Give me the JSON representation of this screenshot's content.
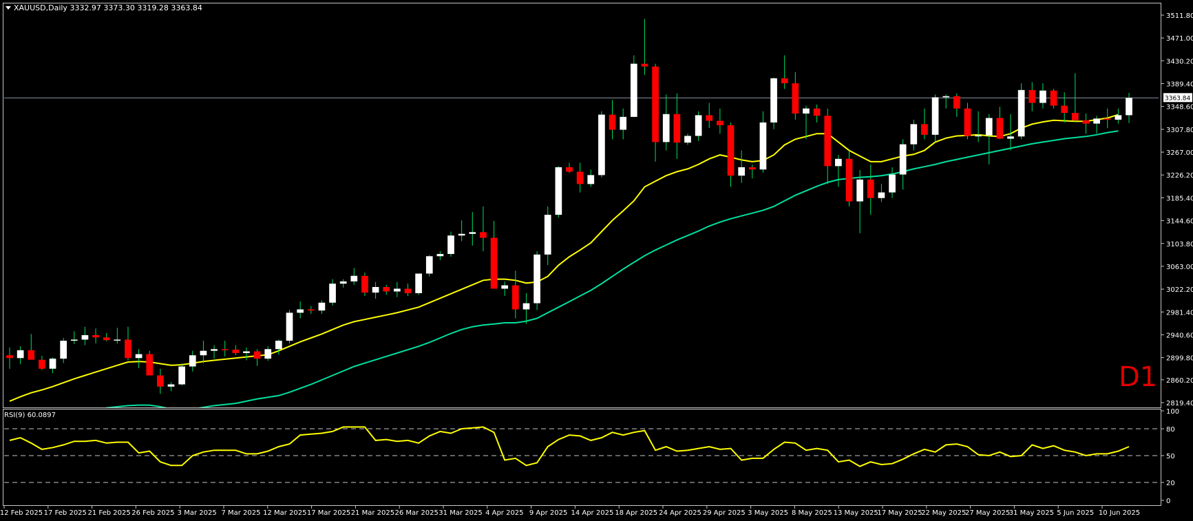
{
  "header": {
    "symbol_info": "XAUUSD,Daily  3332.97 3373.30 3319.28 3363.84"
  },
  "rsi_header": {
    "label": "RSI(9) 60.0897"
  },
  "timeframe_label": "D1",
  "colors": {
    "background": "#000000",
    "bull_candle": "#ffffff",
    "bear_candle": "#ff0000",
    "ma_fast": "#ffff00",
    "ma_slow": "#00e0a0",
    "rsi_line": "#ffff00",
    "price_line": "#8c97a8",
    "timeframe": "#e00000"
  },
  "chart_data": [
    {
      "type": "candlestick",
      "title": "XAUUSD,Daily",
      "ylim": [
        2819.4,
        3511.8
      ],
      "y_ticks": [
        "3511.80",
        "3471.00",
        "3430.20",
        "3389.40",
        "3348.60",
        "3307.80",
        "3267.00",
        "3226.20",
        "3185.40",
        "3144.60",
        "3103.80",
        "3063.00",
        "3022.20",
        "2981.40",
        "2940.60",
        "2899.80",
        "2860.20",
        "2819.40"
      ],
      "current_price": "3363.84",
      "x_tick_labels": [
        "12 Feb 2025",
        "17 Feb 2025",
        "21 Feb 2025",
        "26 Feb 2025",
        "3 Mar 2025",
        "7 Mar 2025",
        "12 Mar 2025",
        "17 Mar 2025",
        "21 Mar 2025",
        "26 Mar 2025",
        "31 Mar 2025",
        "4 Apr 2025",
        "9 Apr 2025",
        "14 Apr 2025",
        "18 Apr 2025",
        "24 Apr 2025",
        "29 Apr 2025",
        "3 May 2025",
        "8 May 2025",
        "13 May 2025",
        "17 May 2025",
        "22 May 2025",
        "27 May 2025",
        "31 May 2025",
        "5 Jun 2025",
        "10 Jun 2025"
      ],
      "candles": [
        [
          2904,
          2918,
          2880,
          2899
        ],
        [
          2899,
          2920,
          2888,
          2913
        ],
        [
          2913,
          2942,
          2902,
          2896
        ],
        [
          2896,
          2903,
          2878,
          2880
        ],
        [
          2880,
          2900,
          2872,
          2898
        ],
        [
          2898,
          2935,
          2890,
          2930
        ],
        [
          2930,
          2947,
          2924,
          2932
        ],
        [
          2932,
          2955,
          2922,
          2940
        ],
        [
          2940,
          2952,
          2925,
          2936
        ],
        [
          2936,
          2944,
          2929,
          2931
        ],
        [
          2931,
          2953,
          2925,
          2932
        ],
        [
          2932,
          2955,
          2895,
          2899
        ],
        [
          2899,
          2915,
          2881,
          2906
        ],
        [
          2906,
          2912,
          2875,
          2868
        ],
        [
          2868,
          2880,
          2835,
          2848
        ],
        [
          2848,
          2856,
          2840,
          2852
        ],
        [
          2852,
          2890,
          2850,
          2884
        ],
        [
          2884,
          2912,
          2875,
          2904
        ],
        [
          2904,
          2930,
          2890,
          2912
        ],
        [
          2912,
          2922,
          2898,
          2915
        ],
        [
          2915,
          2930,
          2902,
          2914
        ],
        [
          2914,
          2922,
          2904,
          2908
        ],
        [
          2908,
          2918,
          2895,
          2911
        ],
        [
          2911,
          2915,
          2885,
          2898
        ],
        [
          2898,
          2920,
          2894,
          2915
        ],
        [
          2915,
          2932,
          2905,
          2930
        ],
        [
          2930,
          2985,
          2925,
          2980
        ],
        [
          2980,
          3000,
          2970,
          2986
        ],
        [
          2986,
          2992,
          2978,
          2984
        ],
        [
          2984,
          3002,
          2978,
          2998
        ],
        [
          2998,
          3040,
          2993,
          3032
        ],
        [
          3032,
          3040,
          3025,
          3036
        ],
        [
          3036,
          3060,
          3030,
          3046
        ],
        [
          3046,
          3052,
          3010,
          3016
        ],
        [
          3016,
          3035,
          3005,
          3026
        ],
        [
          3026,
          3030,
          3012,
          3018
        ],
        [
          3018,
          3035,
          3008,
          3023
        ],
        [
          3023,
          3032,
          3010,
          3015
        ],
        [
          3015,
          3050,
          3012,
          3050
        ],
        [
          3050,
          3083,
          3045,
          3081
        ],
        [
          3081,
          3090,
          3074,
          3085
        ],
        [
          3085,
          3125,
          3080,
          3118
        ],
        [
          3118,
          3145,
          3108,
          3121
        ],
        [
          3121,
          3160,
          3100,
          3124
        ],
        [
          3124,
          3170,
          3090,
          3114
        ],
        [
          3114,
          3144,
          3036,
          3023
        ],
        [
          3023,
          3036,
          3010,
          3029
        ],
        [
          3029,
          3055,
          2970,
          2986
        ],
        [
          2986,
          3015,
          2960,
          2997
        ],
        [
          2997,
          3090,
          2985,
          3084
        ],
        [
          3084,
          3170,
          3065,
          3155
        ],
        [
          3155,
          3242,
          3150,
          3240
        ],
        [
          3240,
          3248,
          3230,
          3232
        ],
        [
          3232,
          3248,
          3195,
          3210
        ],
        [
          3210,
          3236,
          3205,
          3226
        ],
        [
          3226,
          3340,
          3222,
          3334
        ],
        [
          3334,
          3360,
          3290,
          3307
        ],
        [
          3307,
          3345,
          3290,
          3330
        ],
        [
          3330,
          3440,
          3330,
          3425
        ],
        [
          3425,
          3505,
          3405,
          3420
        ],
        [
          3420,
          3425,
          3250,
          3285
        ],
        [
          3285,
          3370,
          3270,
          3335
        ],
        [
          3335,
          3372,
          3255,
          3284
        ],
        [
          3284,
          3300,
          3280,
          3296
        ],
        [
          3296,
          3340,
          3287,
          3333
        ],
        [
          3333,
          3355,
          3310,
          3323
        ],
        [
          3323,
          3345,
          3300,
          3315
        ],
        [
          3315,
          3320,
          3205,
          3225
        ],
        [
          3225,
          3270,
          3212,
          3240
        ],
        [
          3240,
          3245,
          3220,
          3236
        ],
        [
          3236,
          3340,
          3230,
          3320
        ],
        [
          3320,
          3400,
          3308,
          3399
        ],
        [
          3399,
          3440,
          3380,
          3390
        ],
        [
          3390,
          3410,
          3325,
          3336
        ],
        [
          3336,
          3350,
          3290,
          3345
        ],
        [
          3345,
          3352,
          3320,
          3332
        ],
        [
          3332,
          3345,
          3210,
          3242
        ],
        [
          3242,
          3262,
          3205,
          3255
        ],
        [
          3255,
          3270,
          3170,
          3179
        ],
        [
          3179,
          3235,
          3122,
          3218
        ],
        [
          3218,
          3245,
          3155,
          3185
        ],
        [
          3185,
          3210,
          3178,
          3195
        ],
        [
          3195,
          3240,
          3185,
          3227
        ],
        [
          3227,
          3290,
          3200,
          3281
        ],
        [
          3281,
          3325,
          3270,
          3317
        ],
        [
          3317,
          3345,
          3290,
          3298
        ],
        [
          3298,
          3370,
          3285,
          3365
        ],
        [
          3365,
          3370,
          3345,
          3367
        ],
        [
          3367,
          3372,
          3330,
          3345
        ],
        [
          3345,
          3355,
          3290,
          3296
        ],
        [
          3296,
          3340,
          3285,
          3297
        ],
        [
          3297,
          3335,
          3245,
          3328
        ],
        [
          3328,
          3348,
          3290,
          3291
        ],
        [
          3291,
          3335,
          3270,
          3295
        ],
        [
          3295,
          3390,
          3290,
          3378
        ],
        [
          3378,
          3392,
          3340,
          3355
        ],
        [
          3355,
          3390,
          3345,
          3377
        ],
        [
          3377,
          3380,
          3345,
          3350
        ],
        [
          3350,
          3374,
          3320,
          3337
        ],
        [
          3337,
          3408,
          3320,
          3324
        ],
        [
          3324,
          3336,
          3300,
          3318
        ],
        [
          3318,
          3332,
          3300,
          3327
        ],
        [
          3327,
          3345,
          3310,
          3325
        ],
        [
          3325,
          3345,
          3318,
          3333
        ],
        [
          3333,
          3373,
          3319,
          3364
        ]
      ],
      "series": [
        {
          "name": "",
          "values": [
            2822,
            2830,
            2837,
            2842,
            2848,
            2855,
            2862,
            2868,
            2874,
            2880,
            2886,
            2892,
            2893,
            2892,
            2889,
            2886,
            2887,
            2890,
            2893,
            2895,
            2897,
            2899,
            2901,
            2903,
            2905,
            2912,
            2920,
            2928,
            2935,
            2942,
            2950,
            2958,
            2964,
            2968,
            2972,
            2976,
            2980,
            2985,
            2990,
            2998,
            3006,
            3014,
            3022,
            3030,
            3038,
            3040,
            3040,
            3038,
            3033,
            3035,
            3045,
            3065,
            3080,
            3092,
            3105,
            3125,
            3145,
            3162,
            3180,
            3205,
            3215,
            3225,
            3232,
            3237,
            3245,
            3255,
            3262,
            3258,
            3253,
            3250,
            3252,
            3262,
            3280,
            3290,
            3295,
            3300,
            3300,
            3285,
            3270,
            3260,
            3250,
            3250,
            3255,
            3260,
            3263,
            3270,
            3285,
            3292,
            3296,
            3297,
            3298,
            3296,
            3295,
            3300,
            3310,
            3317,
            3321,
            3324,
            3323,
            3322,
            3322,
            3325,
            3328,
            3334
          ]
        },
        {
          "name": "",
          "values": [
            2765,
            2770,
            2775,
            2780,
            2785,
            2790,
            2795,
            2800,
            2805,
            2810,
            2812,
            2814,
            2815,
            2815,
            2812,
            2808,
            2806,
            2808,
            2811,
            2814,
            2816,
            2818,
            2822,
            2826,
            2829,
            2832,
            2838,
            2845,
            2852,
            2860,
            2868,
            2876,
            2884,
            2890,
            2896,
            2902,
            2908,
            2914,
            2920,
            2927,
            2935,
            2943,
            2950,
            2955,
            2958,
            2960,
            2962,
            2962,
            2965,
            2970,
            2980,
            2990,
            3000,
            3010,
            3020,
            3032,
            3045,
            3058,
            3070,
            3082,
            3092,
            3101,
            3110,
            3118,
            3126,
            3135,
            3142,
            3148,
            3153,
            3158,
            3163,
            3170,
            3180,
            3190,
            3198,
            3206,
            3213,
            3218,
            3220,
            3222,
            3223,
            3225,
            3228,
            3232,
            3237,
            3241,
            3245,
            3250,
            3254,
            3258,
            3262,
            3266,
            3270,
            3274,
            3278,
            3282,
            3285,
            3288,
            3291,
            3293,
            3295,
            3298,
            3302,
            3305
          ]
        }
      ]
    },
    {
      "type": "line",
      "title": "RSI(9) 60.0897",
      "ylim": [
        0,
        100
      ],
      "y_ticks": [
        "100",
        "80",
        "50",
        "20",
        "0"
      ],
      "levels": [
        80,
        50,
        20
      ],
      "series": [
        {
          "name": "RSI(9)",
          "values": [
            67,
            70,
            64,
            57,
            59,
            62,
            66,
            66,
            67,
            64,
            65,
            65,
            53,
            55,
            43,
            39,
            39,
            50,
            54,
            56,
            56,
            56,
            52,
            52,
            55,
            60,
            63,
            73,
            74,
            75,
            77,
            82,
            82,
            82,
            67,
            68,
            66,
            67,
            64,
            72,
            77,
            75,
            80,
            81,
            82,
            76,
            45,
            47,
            39,
            42,
            60,
            68,
            73,
            72,
            67,
            70,
            76,
            73,
            76,
            78,
            56,
            60,
            55,
            56,
            58,
            60,
            57,
            58,
            45,
            47,
            47,
            57,
            65,
            64,
            56,
            58,
            56,
            43,
            45,
            38,
            43,
            40,
            41,
            46,
            52,
            57,
            54,
            62,
            63,
            60,
            51,
            50,
            54,
            49,
            50,
            62,
            58,
            61,
            56,
            54,
            50,
            52,
            52,
            55,
            60
          ]
        }
      ]
    }
  ]
}
